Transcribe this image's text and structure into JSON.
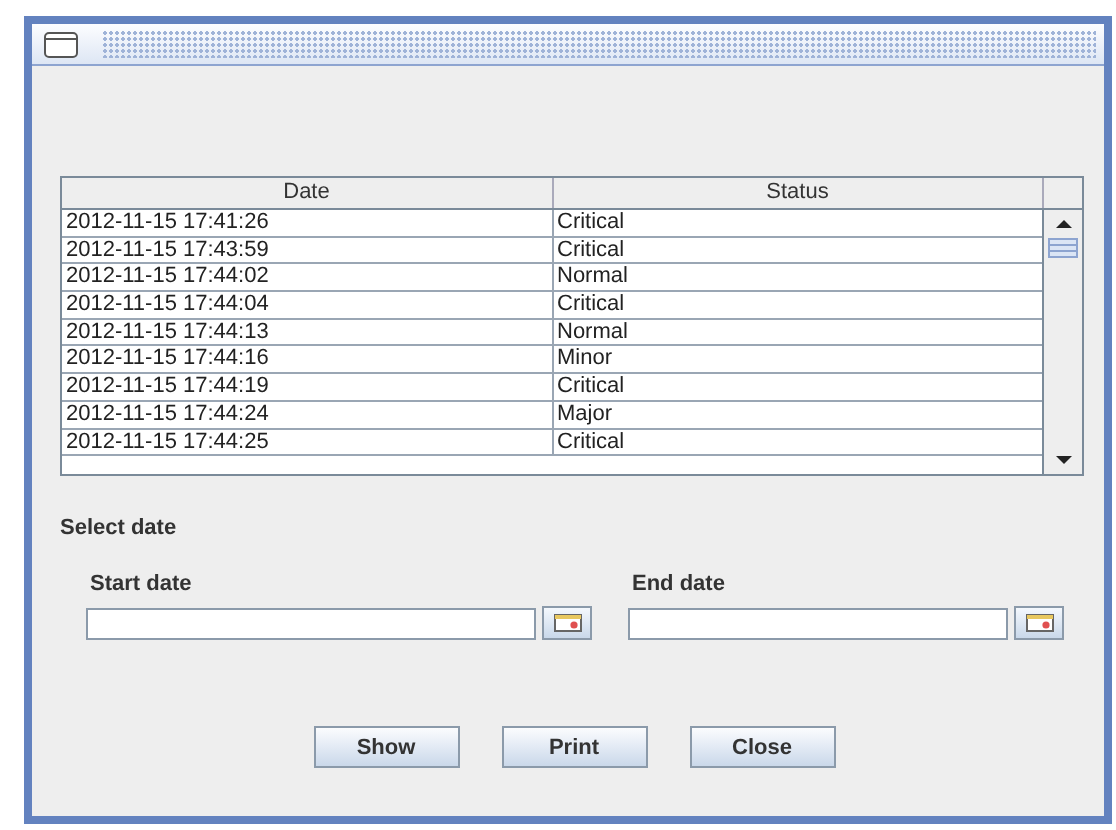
{
  "table": {
    "columns": [
      "Date",
      "Status"
    ],
    "rows": [
      [
        "2012-11-15 17:41:26",
        "Critical"
      ],
      [
        "2012-11-15 17:43:59",
        "Critical"
      ],
      [
        "2012-11-15 17:44:02",
        "Normal"
      ],
      [
        "2012-11-15 17:44:04",
        "Critical"
      ],
      [
        "2012-11-15 17:44:13",
        "Normal"
      ],
      [
        "2012-11-15 17:44:16",
        "Minor"
      ],
      [
        "2012-11-15 17:44:19",
        "Critical"
      ],
      [
        "2012-11-15 17:44:24",
        "Major"
      ],
      [
        "2012-11-15 17:44:25",
        "Critical"
      ]
    ]
  },
  "select_date": {
    "title": "Select date",
    "fields": [
      {
        "label": "Start date"
      },
      {
        "label": "End date"
      }
    ]
  },
  "buttons": [
    "Show",
    "Print",
    "Close"
  ]
}
